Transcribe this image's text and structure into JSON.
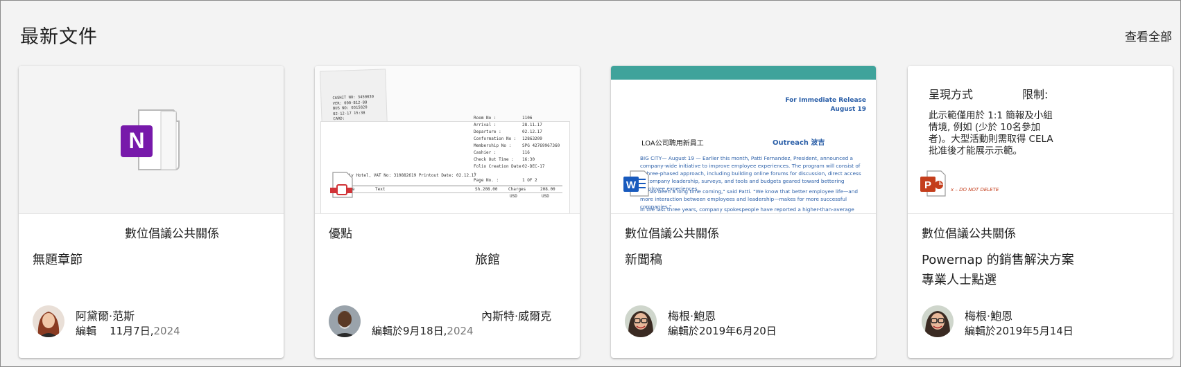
{
  "section": {
    "title": "最新文件",
    "view_all": "查看全部"
  },
  "cards": [
    {
      "app": "onenote",
      "app_icon": "onenote-icon",
      "notebook": "數位倡議公共關係",
      "title": "無題章節",
      "title2": "",
      "author": "阿黛爾·范斯",
      "edited_prefix": "編輯",
      "edited_date": "11月7日,",
      "edited_year": "2024"
    },
    {
      "app": "pdf",
      "app_icon": "pdf-icon",
      "notebook": "優點",
      "title": "旅館",
      "title2": "",
      "author": "內斯特·威爾克",
      "edited_prefix": "編輯於9月18日,",
      "edited_date": "",
      "edited_year": "2024"
    },
    {
      "app": "word",
      "app_icon": "word-icon",
      "notebook": "數位倡議公共關係",
      "title": "新聞稿",
      "title2": "",
      "author": "梅根·鮑恩",
      "edited_prefix": "編輯於2019年6月20日",
      "edited_date": "",
      "edited_year": ""
    },
    {
      "app": "powerpoint",
      "app_icon": "powerpoint-icon",
      "notebook": "數位倡議公共關係",
      "title": "Powernap 的銷售解決方案",
      "title2": "專業人士點選",
      "author": "梅根·鮑恩",
      "edited_prefix": "編輯於2019年5月14日",
      "edited_date": "",
      "edited_year": ""
    }
  ],
  "thumbs": {
    "receipt": {
      "slip_lines": [
        "CASHIT NO: 3450030",
        "VER: 000-812-88",
        "BUS NO: 0315820",
        "02-12-17  15:38",
        "CARD:",
        "Amex",
        "RECEIPT: 273001810",
        "TRAN TYPE:",
        "Approved Debit",
        "Auth: 2 0360460",
        "TRAN CODE:",
        "CURRENCY: USD",
        "CREDIT TERM:",
        "AMNT: 1008.98",
        "THANK YOU !",
        "COME AGAIN !"
      ],
      "fields": [
        [
          "Room No :",
          "1106"
        ],
        [
          "Arrival :",
          "28.11.17"
        ],
        [
          "Departure :",
          "02.12.17"
        ],
        [
          "Conformation No :",
          "12863209"
        ],
        [
          "Membership No :",
          "SPG    42769967360"
        ],
        [
          "Cashier :",
          "116"
        ],
        [
          "Check Out Time :",
          "16:30"
        ],
        [
          "Folio Creation Date :",
          "02-DEC-17"
        ],
        [
          "Page No. :",
          "1 OF 2"
        ]
      ],
      "footer": "Tel Aviv Hotel,     VAT No: 310882619      Printout Date:        02.12.17",
      "table_head": [
        "Date",
        "Text",
        "Sh.208.00",
        "Charges",
        "208.00"
      ],
      "table_sub": [
        "USD",
        "USD"
      ]
    },
    "press": {
      "head1": "For Immediate Release",
      "head2": "August 19",
      "line1": "LOA公司聘用新員工",
      "line1b": "Outreach 波吉",
      "para1": "BIG CITY— August 19 — Earlier this month, Patti Fernandez, President, announced a company-wide initiative to improve employee experiences. The program will consist of a three-phased approach, including building online forums for discussion, direct access to company leadership, surveys, and tools and budgets geared toward bettering employee experiences.",
      "para2": "\"It has been a long time coming,\" said Patti. \"We know that better employee life—and more interaction between employees and leadership—makes for more successful companies.\"",
      "para3": "In the last three years, company spokespeople have reported a higher-than-average rate of"
    },
    "ppt": {
      "l1": "呈現方式",
      "l1b": "限制:",
      "body": "此示範僅用於 1:1 簡報及小組情境, 例如 (少於 10名參加者)。大型活動則需取得 CELA 批准後才能展示示範。",
      "note": "x – DO NOT DELETE"
    }
  },
  "colors": {
    "onenote": "#7719aa",
    "word": "#185abd",
    "powerpoint": "#c43e1c",
    "pdf": "#d13438",
    "accent_band": "#3fa39b"
  }
}
